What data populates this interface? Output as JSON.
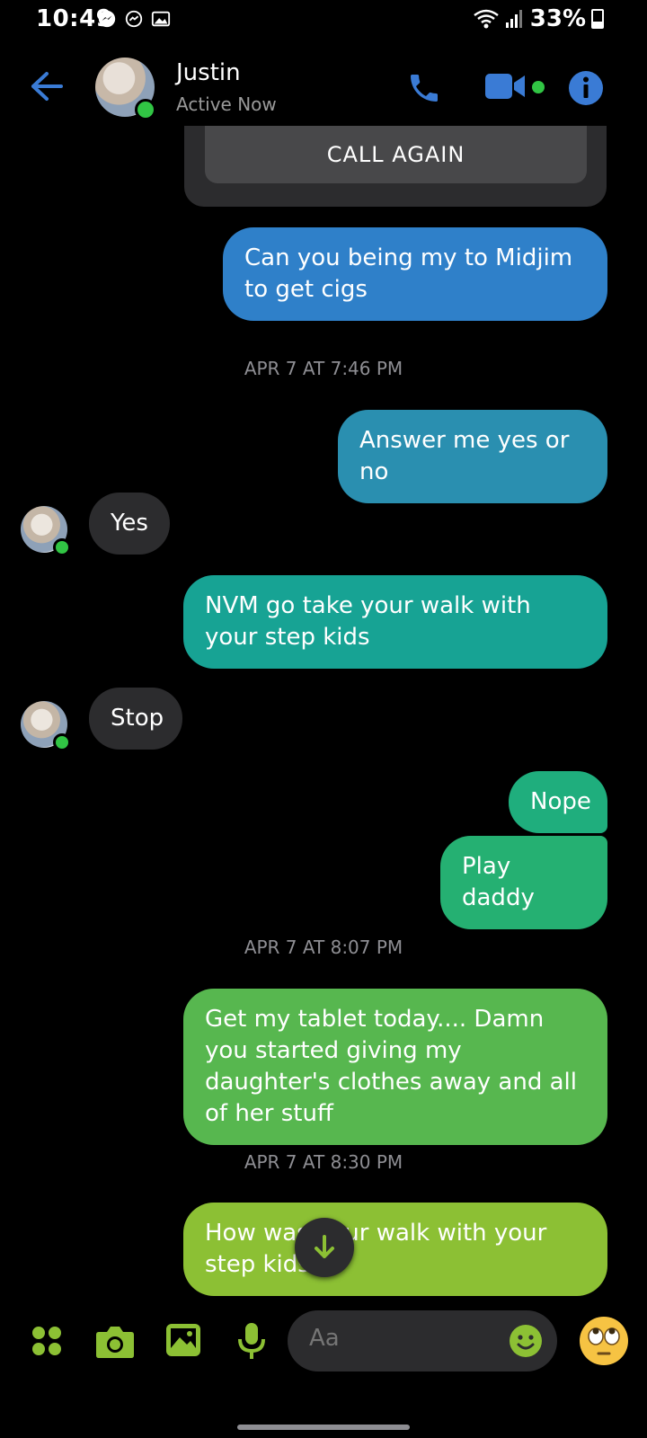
{
  "status_bar": {
    "time": "10:49",
    "battery": "33%"
  },
  "header": {
    "name": "Justin",
    "status": "Active Now"
  },
  "call_card": {
    "button_label": "CALL AGAIN"
  },
  "messages": [
    {
      "text": "Can you being my  to Midjim to get cigs",
      "color": "#2f80c9"
    },
    {
      "timestamp": "APR 7 AT 7:46 PM"
    },
    {
      "text": "Answer me yes or no",
      "color": "#2a8fb0"
    },
    {
      "text": "Yes",
      "incoming": true
    },
    {
      "text": "NVM go take your walk with your step kids",
      "color": "#17a394"
    },
    {
      "text": "Stop",
      "incoming": true
    },
    {
      "text": "Nope",
      "color": "#1fae7d"
    },
    {
      "text": "Play daddy",
      "color": "#25b072"
    },
    {
      "timestamp": "APR 7 AT 8:07 PM"
    },
    {
      "text": "Get my tablet today.... Damn you started giving my daughter's clothes away and all of her stuff",
      "color": "#57b74f"
    },
    {
      "timestamp": "APR 7 AT 8:30 PM"
    },
    {
      "text": "How was your walk with your step kids",
      "color": "#8cc034"
    }
  ],
  "composer": {
    "placeholder": "Aa"
  },
  "icons": {
    "back": "back-arrow-icon",
    "phone": "phone-icon",
    "video": "video-camera-icon",
    "info": "info-icon",
    "apps": "apps-grid-icon",
    "camera": "camera-icon",
    "gallery": "gallery-icon",
    "mic": "microphone-icon",
    "emoji": "emoji-icon",
    "reaction": "eye-roll-emoji-icon",
    "scroll_down": "arrow-down-icon"
  },
  "colors": {
    "accent_blue": "#3a7bd5",
    "composer_green": "#8cc034",
    "online": "#31c544"
  }
}
